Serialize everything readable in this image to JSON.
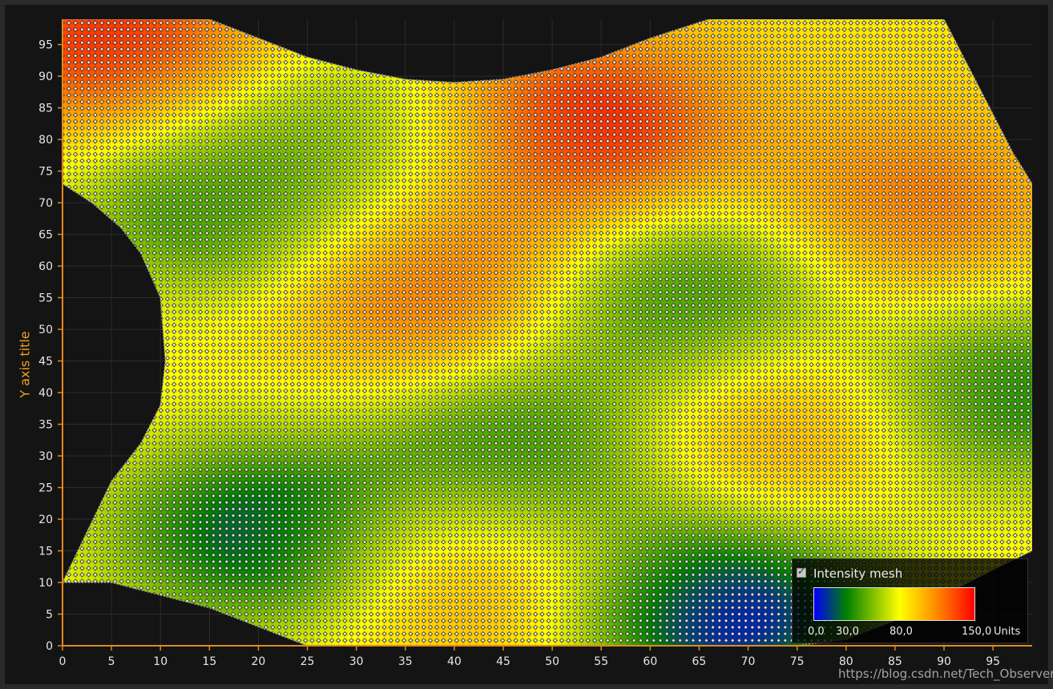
{
  "chart_data": {
    "type": "heatmap",
    "title": "",
    "xlabel": "",
    "ylabel": "Y axis title",
    "xlim": [
      0,
      99
    ],
    "ylim": [
      0,
      99
    ],
    "x_ticks": [
      0,
      5,
      10,
      15,
      20,
      25,
      30,
      35,
      40,
      45,
      50,
      55,
      60,
      65,
      70,
      75,
      80,
      85,
      90,
      95
    ],
    "y_ticks": [
      0,
      5,
      10,
      15,
      20,
      25,
      30,
      35,
      40,
      45,
      50,
      55,
      60,
      65,
      70,
      75,
      80,
      85,
      90,
      95
    ],
    "grid": true,
    "legend_position": "bottom-right",
    "series": [
      {
        "name": "Intensity mesh",
        "visible": true
      }
    ],
    "value_range": [
      0,
      150
    ],
    "palette": [
      {
        "value": 0,
        "color": "#0000ff"
      },
      {
        "value": 30,
        "color": "#008000"
      },
      {
        "value": 80,
        "color": "#ffff00"
      },
      {
        "value": 115,
        "color": "#ff8c00"
      },
      {
        "value": 150,
        "color": "#ff0000"
      }
    ],
    "legend_labels": [
      "0,0",
      "30,0",
      "80,0",
      "150,0"
    ],
    "legend_units": "Units",
    "hotspots": [
      {
        "x": 5,
        "y": 95,
        "value": 140
      },
      {
        "x": 53,
        "y": 82,
        "value": 145
      },
      {
        "x": 38,
        "y": 57,
        "value": 130
      },
      {
        "x": 87,
        "y": 70,
        "value": 120
      },
      {
        "x": 72,
        "y": 35,
        "value": 115
      },
      {
        "x": 42,
        "y": 12,
        "value": 115
      },
      {
        "x": 63,
        "y": 55,
        "value": 30
      },
      {
        "x": 20,
        "y": 18,
        "value": 20
      },
      {
        "x": 68,
        "y": 5,
        "value": 5
      },
      {
        "x": 47,
        "y": 30,
        "value": 30
      },
      {
        "x": 15,
        "y": 70,
        "value": 40
      },
      {
        "x": 97,
        "y": 40,
        "value": 35
      },
      {
        "x": 30,
        "y": 80,
        "value": 55
      }
    ],
    "mesh_outline": {
      "bottom": [
        [
          0,
          10
        ],
        [
          5,
          10
        ],
        [
          10,
          8
        ],
        [
          15,
          6
        ],
        [
          20,
          3
        ],
        [
          25,
          0
        ],
        [
          75,
          0
        ],
        [
          80,
          1
        ],
        [
          85,
          4
        ],
        [
          90,
          8
        ],
        [
          95,
          12
        ],
        [
          99,
          15
        ]
      ],
      "right": [
        [
          99,
          73
        ],
        [
          97,
          78
        ],
        [
          95,
          84
        ],
        [
          93,
          90
        ],
        [
          90,
          99
        ]
      ],
      "top": [
        [
          66,
          99
        ],
        [
          60,
          96
        ],
        [
          55,
          93
        ],
        [
          50,
          91
        ],
        [
          45,
          89.5
        ],
        [
          40,
          89
        ],
        [
          35,
          89.5
        ],
        [
          30,
          91
        ],
        [
          25,
          93
        ],
        [
          20,
          96
        ],
        [
          15,
          99
        ],
        [
          0,
          99
        ]
      ],
      "left": [
        [
          0,
          73
        ],
        [
          3,
          70
        ],
        [
          6,
          66
        ],
        [
          8,
          62
        ],
        [
          10,
          55
        ],
        [
          10.5,
          45
        ],
        [
          10,
          38
        ],
        [
          8,
          32
        ],
        [
          5,
          26
        ],
        [
          0,
          10
        ]
      ]
    }
  },
  "watermark": "https://blog.csdn.net/Tech_Observer"
}
